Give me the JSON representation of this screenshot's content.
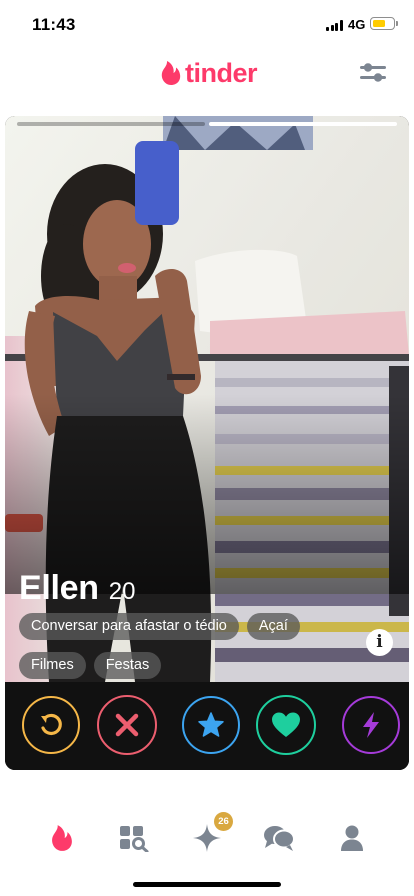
{
  "status_bar": {
    "time": "11:43",
    "network": "4G",
    "battery_color": "#ffcc00"
  },
  "header": {
    "logo_text": "tinder",
    "brand_color": "#fd3a6a",
    "filter_icon": "sliders-icon"
  },
  "card": {
    "photo_count": 2,
    "active_photo": 2,
    "name": "Ellen",
    "age": "20",
    "tags_row1": [
      "Conversar para afastar o tédio",
      "Açaí"
    ],
    "tags_row2": [
      "Filmes",
      "Festas"
    ],
    "info_label": "i"
  },
  "actions": [
    {
      "name": "rewind",
      "icon": "rewind-icon",
      "color": "#f5b748"
    },
    {
      "name": "nope",
      "icon": "close-icon",
      "color": "#ec5e6f"
    },
    {
      "name": "super-like",
      "icon": "star-icon",
      "color": "#3ca4f0"
    },
    {
      "name": "like",
      "icon": "heart-icon",
      "color": "#1ecf9e"
    },
    {
      "name": "boost",
      "icon": "lightning-icon",
      "color": "#a53bd9"
    }
  ],
  "bottom_nav": {
    "items": [
      {
        "name": "home",
        "icon": "flame-icon",
        "active": true
      },
      {
        "name": "explore",
        "icon": "explore-icon",
        "active": false
      },
      {
        "name": "likes",
        "icon": "sparkle-icon",
        "active": false
      },
      {
        "name": "messages",
        "icon": "chat-icon",
        "active": false
      },
      {
        "name": "profile",
        "icon": "person-icon",
        "active": false
      }
    ],
    "likes_badge": "26"
  }
}
